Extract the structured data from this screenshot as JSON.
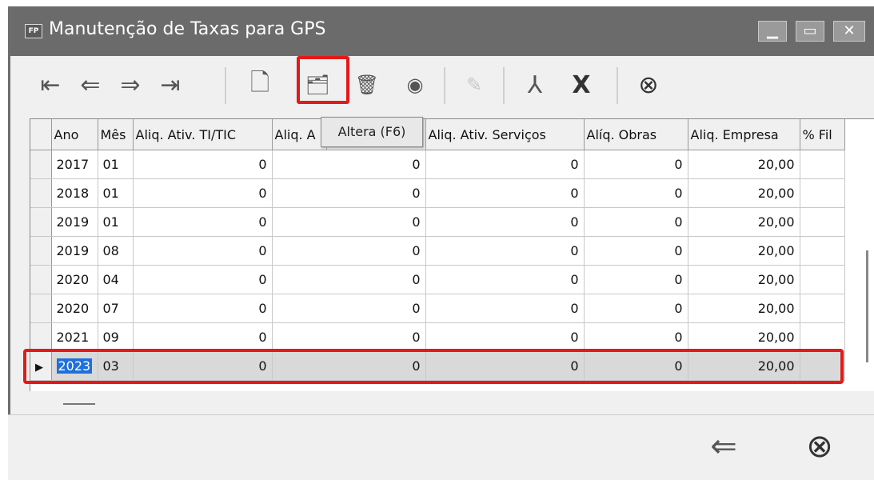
{
  "window": {
    "title": "Manutenção de Taxas para GPS",
    "icon_text": "FP"
  },
  "toolbar": {
    "buttons": [
      {
        "name": "first-record",
        "glyph": "⇤"
      },
      {
        "name": "previous-record",
        "glyph": "⇐"
      },
      {
        "name": "next-record",
        "glyph": "⇒"
      },
      {
        "name": "last-record",
        "glyph": "⇥"
      },
      {
        "name": "new-record",
        "glyph": "🗋"
      },
      {
        "name": "edit-record",
        "glyph": "🗂"
      },
      {
        "name": "delete-record",
        "glyph": "🗑"
      },
      {
        "name": "view-record",
        "glyph": "◉"
      },
      {
        "name": "edit-disabled",
        "glyph": "✎"
      },
      {
        "name": "pdf-export",
        "glyph": "⅄"
      },
      {
        "name": "excel-export",
        "glyph": "X"
      },
      {
        "name": "close",
        "glyph": "⊗"
      }
    ],
    "tooltip": "Altera (F6)"
  },
  "table": {
    "columns": [
      "Ano",
      "Mês",
      "Aliq. Ativ. TI/TIC",
      "Aliq. A",
      "a",
      "Aliq.  Ativ. Serviços",
      "Alíq. Obras",
      "Aliq. Empresa",
      "% Fil"
    ],
    "rows": [
      {
        "ano": "2017",
        "mes": "01",
        "ti": "0",
        "a2": "0",
        "serv": "0",
        "obras": "0",
        "empresa": "20,00"
      },
      {
        "ano": "2018",
        "mes": "01",
        "ti": "0",
        "a2": "0",
        "serv": "0",
        "obras": "0",
        "empresa": "20,00"
      },
      {
        "ano": "2019",
        "mes": "01",
        "ti": "0",
        "a2": "0",
        "serv": "0",
        "obras": "0",
        "empresa": "20,00"
      },
      {
        "ano": "2019",
        "mes": "08",
        "ti": "0",
        "a2": "0",
        "serv": "0",
        "obras": "0",
        "empresa": "20,00"
      },
      {
        "ano": "2020",
        "mes": "04",
        "ti": "0",
        "a2": "0",
        "serv": "0",
        "obras": "0",
        "empresa": "20,00"
      },
      {
        "ano": "2020",
        "mes": "07",
        "ti": "0",
        "a2": "0",
        "serv": "0",
        "obras": "0",
        "empresa": "20,00"
      },
      {
        "ano": "2021",
        "mes": "09",
        "ti": "0",
        "a2": "0",
        "serv": "0",
        "obras": "0",
        "empresa": "20,00"
      },
      {
        "ano": "2023",
        "mes": "03",
        "ti": "0",
        "a2": "0",
        "serv": "0",
        "obras": "0",
        "empresa": "20,00"
      }
    ],
    "selected_row_index": 7
  },
  "footer": {
    "back_glyph": "⇐",
    "close_glyph": "⊗"
  },
  "colors": {
    "highlight": "#e21a1a",
    "titlebar": "#6b6b6b",
    "selection": "#1f6fdc"
  }
}
